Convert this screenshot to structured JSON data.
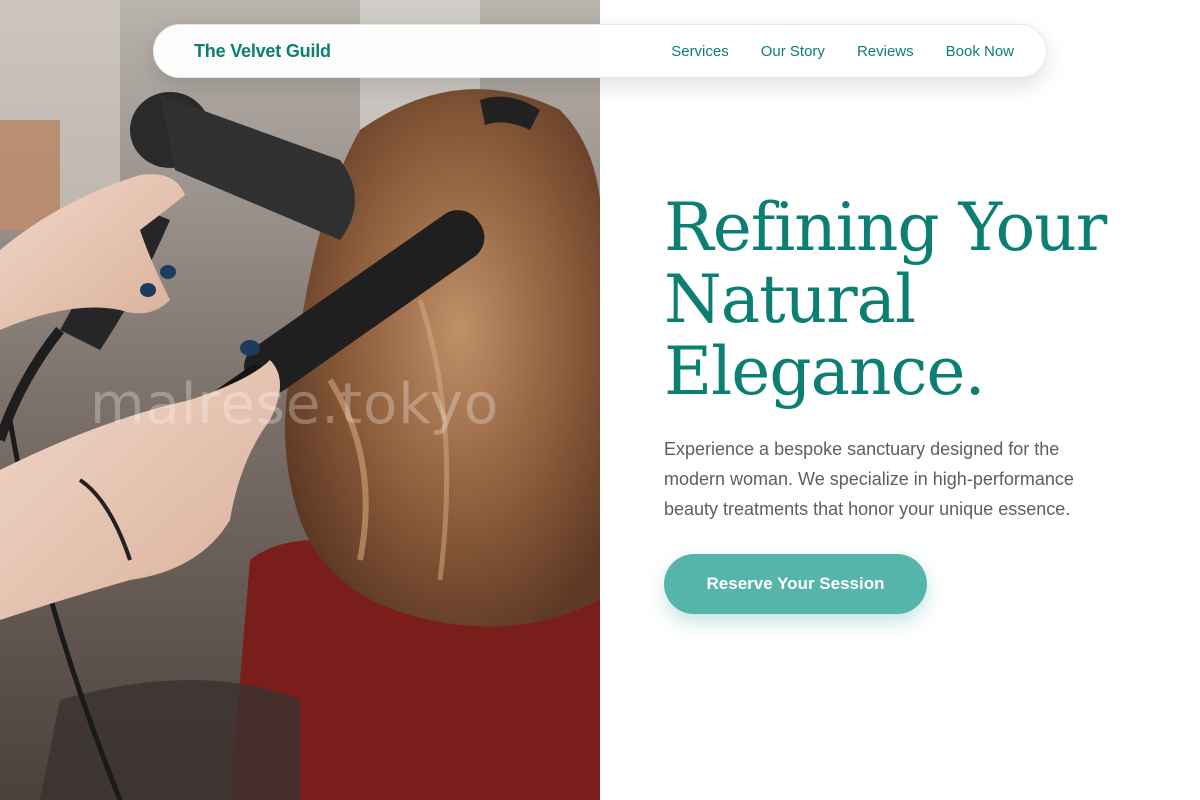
{
  "nav": {
    "brand": "The Velvet Guild",
    "links": [
      "Services",
      "Our Story",
      "Reviews",
      "Book Now"
    ]
  },
  "hero": {
    "title_lines": [
      "Refining Your",
      "Natural",
      "Elegance."
    ],
    "description": "Experience a bespoke sanctuary designed for the modern woman. We specialize in high-performance beauty treatments that honor your unique essence.",
    "cta_label": "Reserve Your Session"
  },
  "photo": {
    "watermark": "malrese.tokyo"
  },
  "colors": {
    "accent": "#0c7f73",
    "button": "#56b5ab",
    "body_text": "#5a5f60"
  }
}
